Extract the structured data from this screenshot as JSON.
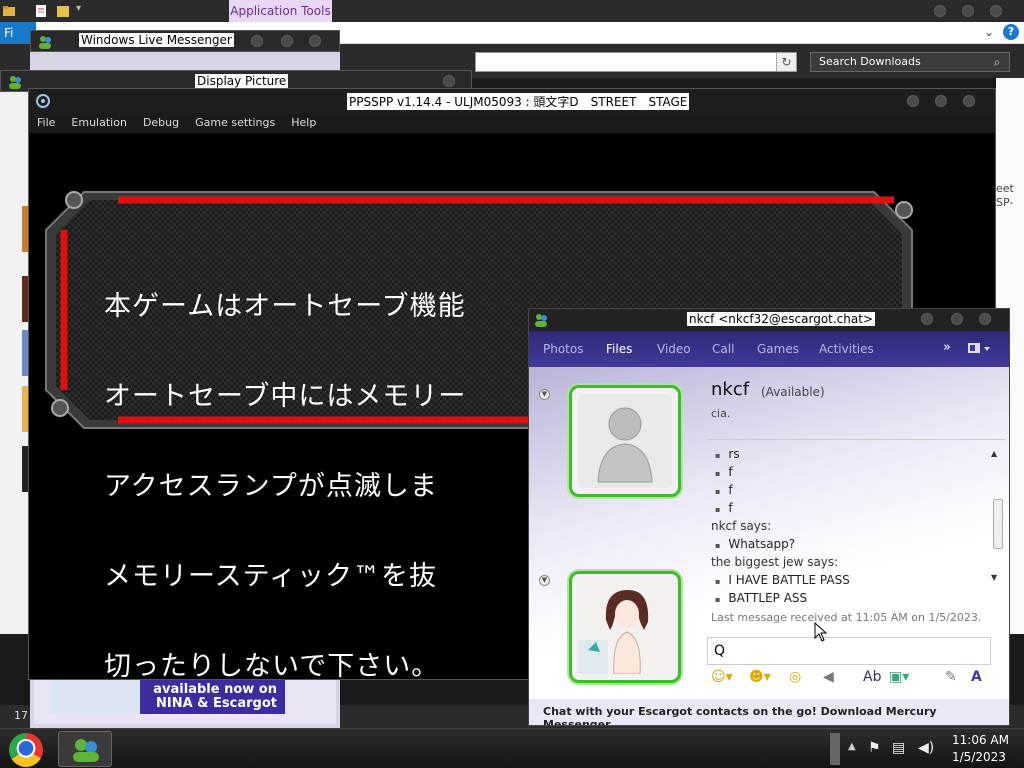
{
  "explorer": {
    "contextual_tab": "Application Tools",
    "file_tab": "Fi",
    "search_placeholder": "Search Downloads",
    "item_count": "17",
    "right_snippet_1": "eet",
    "right_snippet_2": "SP-"
  },
  "messenger": {
    "main_title": "Windows Live Messenger",
    "display_picture_title": "Display Picture",
    "ad_line_1": "available now on",
    "ad_line_2": "NINA & Escargot"
  },
  "ppsspp": {
    "title": "PPSSPP v1.14.4 - ULJM05093 : 頭文字D　STREET　STAGE",
    "menu": [
      "File",
      "Emulation",
      "Debug",
      "Game settings",
      "Help"
    ],
    "banner_lines": [
      "本ゲームはオートセーブ機能",
      "オートセーブ中にはメモリー",
      "アクセスランプが点滅しま",
      "メモリースティック™を抜",
      "切ったりしないで下さい。"
    ]
  },
  "chat": {
    "title": "nkcf <nkcf32@escargot.chat>",
    "tabs": [
      "Photos",
      "Files",
      "Video",
      "Call",
      "Games",
      "Activities"
    ],
    "active_tab": "Files",
    "contact_name": "nkcf",
    "contact_status": "(Available)",
    "contact_psm": "cia.",
    "messages": [
      {
        "kind": "item",
        "text": "rs"
      },
      {
        "kind": "item",
        "text": "f"
      },
      {
        "kind": "item",
        "text": "f"
      },
      {
        "kind": "item",
        "text": "f"
      },
      {
        "kind": "sender",
        "text": "nkcf says:"
      },
      {
        "kind": "item",
        "text": "Whatsapp?"
      },
      {
        "kind": "sender",
        "text": "the biggest jew says:"
      },
      {
        "kind": "item",
        "text": "I HAVE BATTLE PASS"
      },
      {
        "kind": "item",
        "text": "BATTLEP ASS"
      }
    ],
    "last_message": "Last message received at 11:05 AM on 1/5/2023.",
    "input_value": "Q",
    "footer": "Chat with your Escargot contacts on the go! Download Mercury Messenger..."
  },
  "taskbar": {
    "time": "11:06 AM",
    "date": "1/5/2023"
  },
  "colors": {
    "chat_nav": "#3f3a9a",
    "avatar_green": "#3dbb2c",
    "banner_red": "#e01010",
    "contextual_tab": "#e9d8f5"
  }
}
